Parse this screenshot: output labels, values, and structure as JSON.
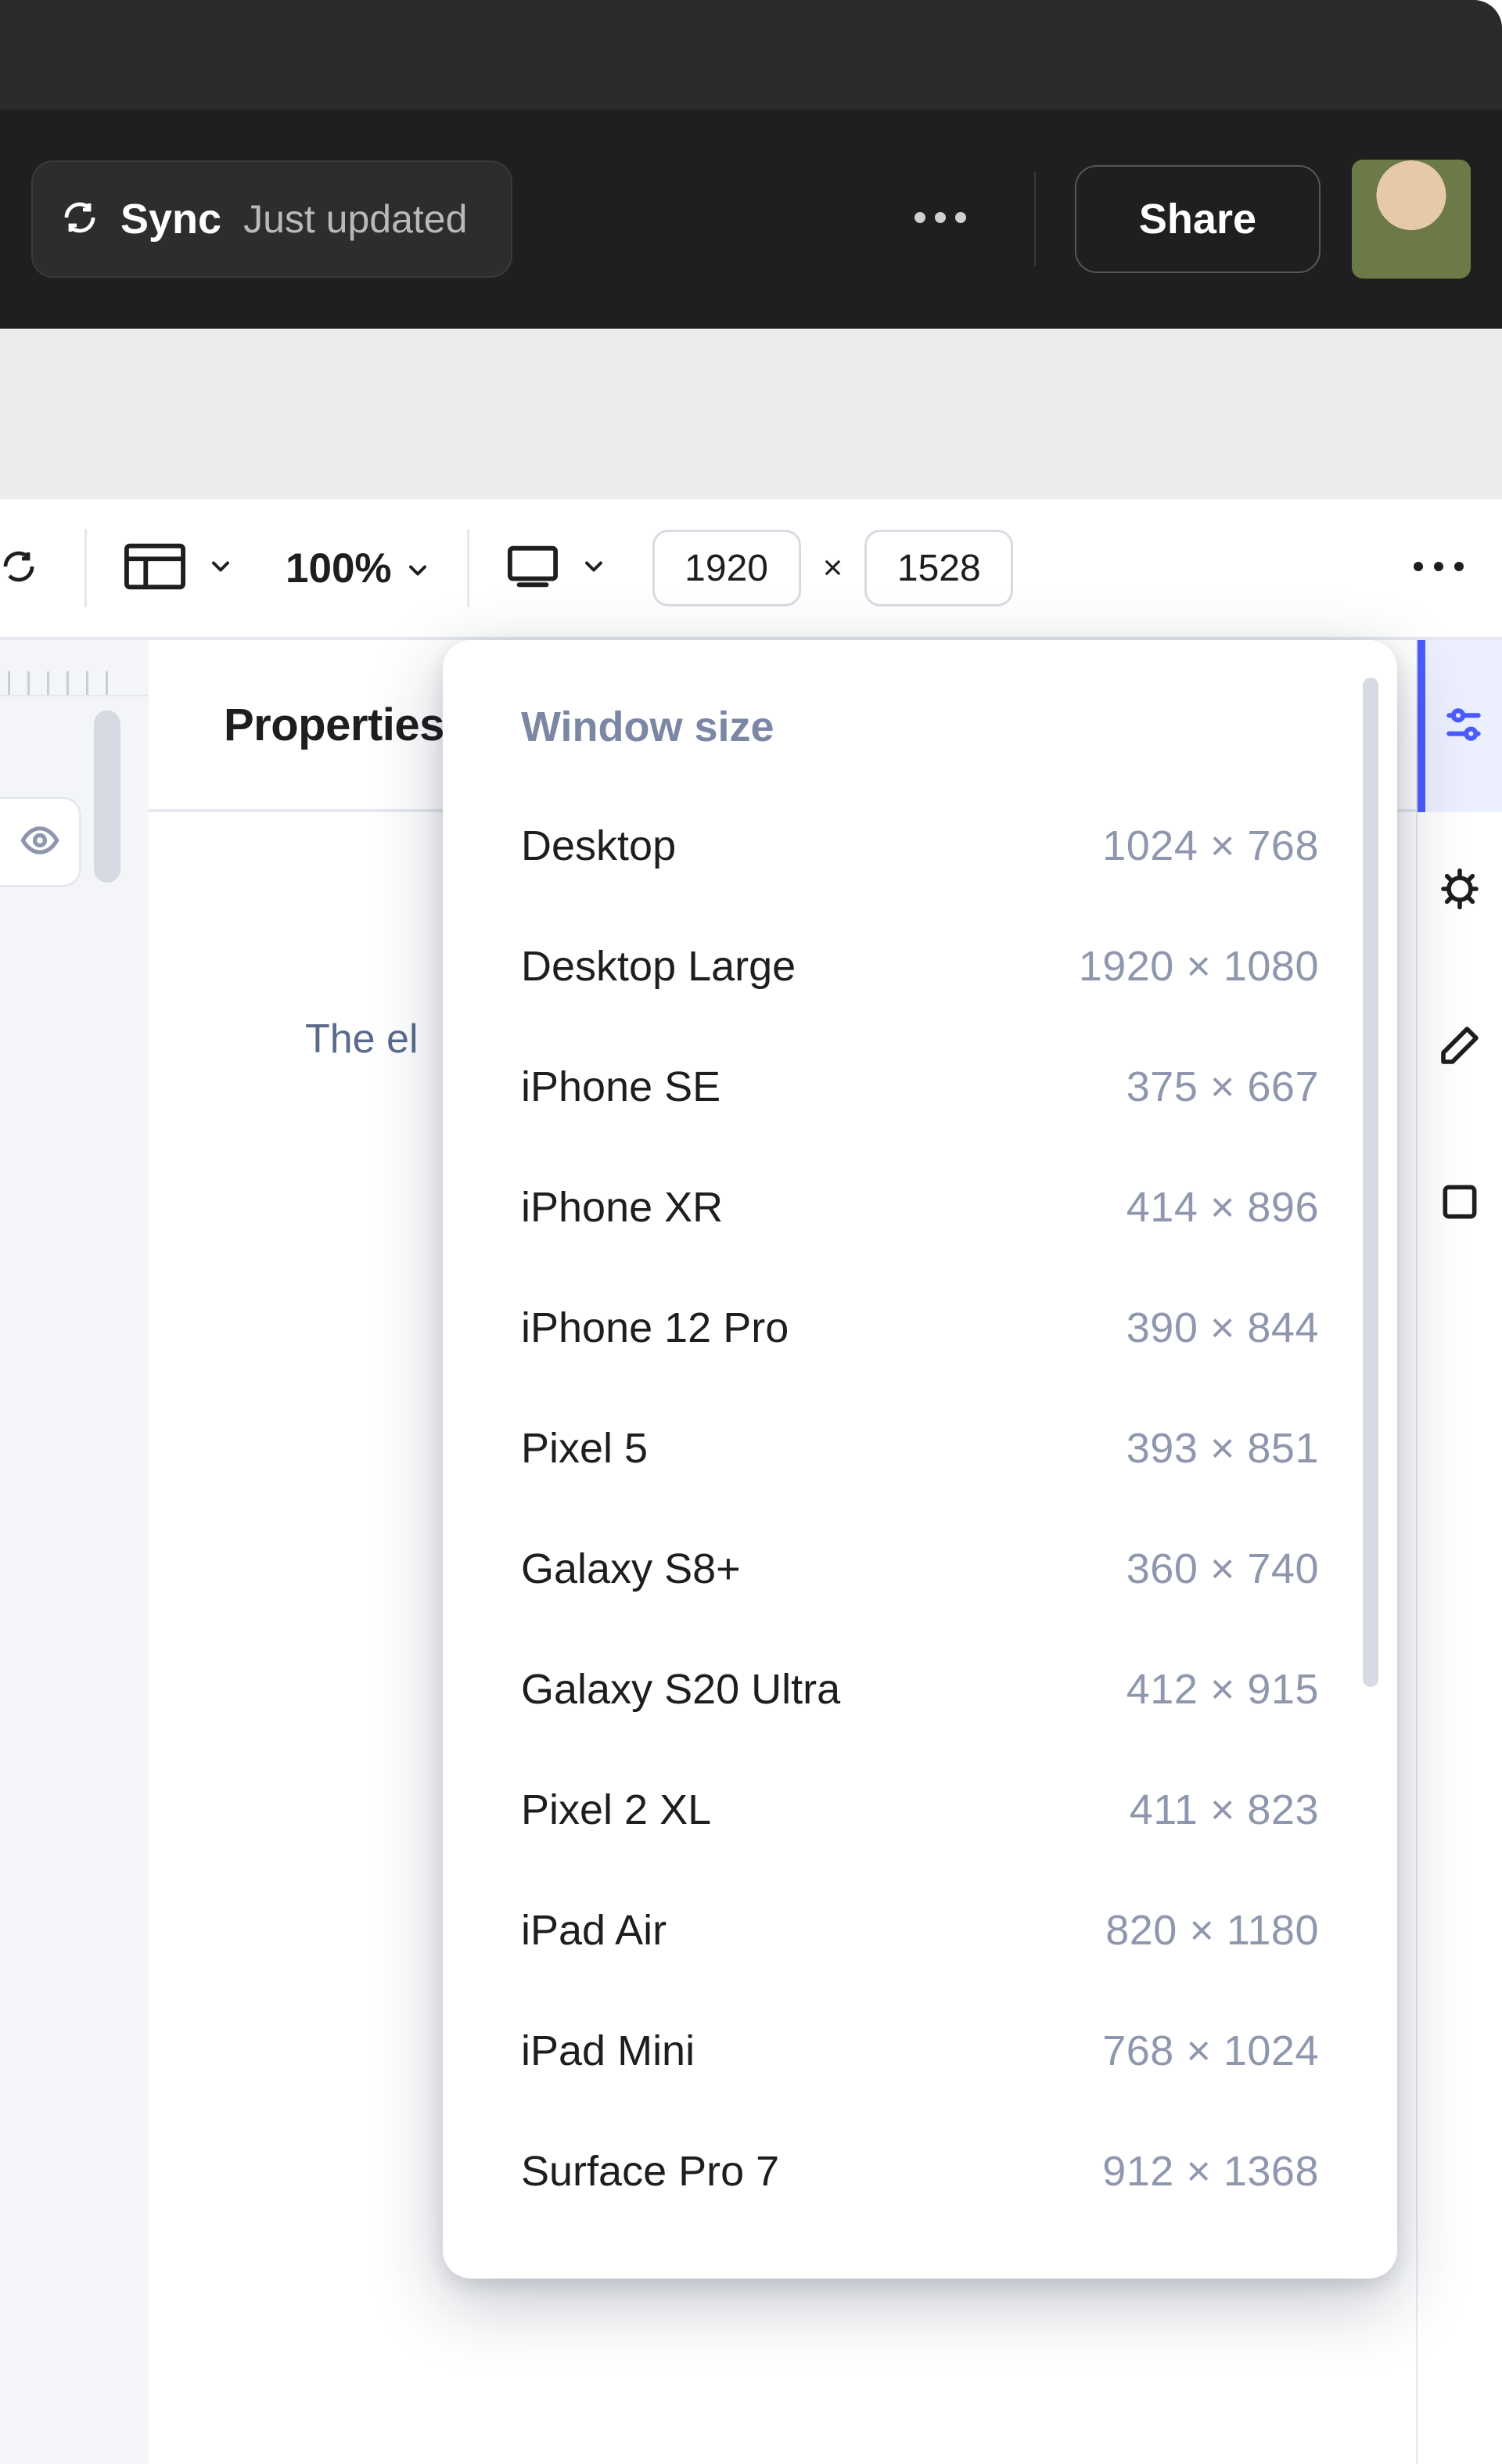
{
  "topbar": {
    "sync_label": "Sync",
    "sync_status": "Just updated",
    "share_label": "Share"
  },
  "toolbar": {
    "zoom": "100%",
    "width": "1920",
    "height": "1528",
    "times": "×"
  },
  "properties": {
    "title": "Properties",
    "placeholder_partial": "The el"
  },
  "dropdown": {
    "header": "Window size",
    "items": [
      {
        "name": "Desktop",
        "dims": "1024 × 768"
      },
      {
        "name": "Desktop Large",
        "dims": "1920 × 1080"
      },
      {
        "name": "iPhone SE",
        "dims": "375 × 667"
      },
      {
        "name": "iPhone XR",
        "dims": "414 × 896"
      },
      {
        "name": "iPhone 12 Pro",
        "dims": "390 × 844"
      },
      {
        "name": "Pixel 5",
        "dims": "393 × 851"
      },
      {
        "name": "Galaxy S8+",
        "dims": "360 × 740"
      },
      {
        "name": "Galaxy S20 Ultra",
        "dims": "412 × 915"
      },
      {
        "name": "Pixel 2 XL",
        "dims": "411 × 823"
      },
      {
        "name": "iPad Air",
        "dims": "820 × 1180"
      },
      {
        "name": "iPad Mini",
        "dims": "768 × 1024"
      },
      {
        "name": "Surface Pro 7",
        "dims": "912 × 1368"
      }
    ]
  }
}
